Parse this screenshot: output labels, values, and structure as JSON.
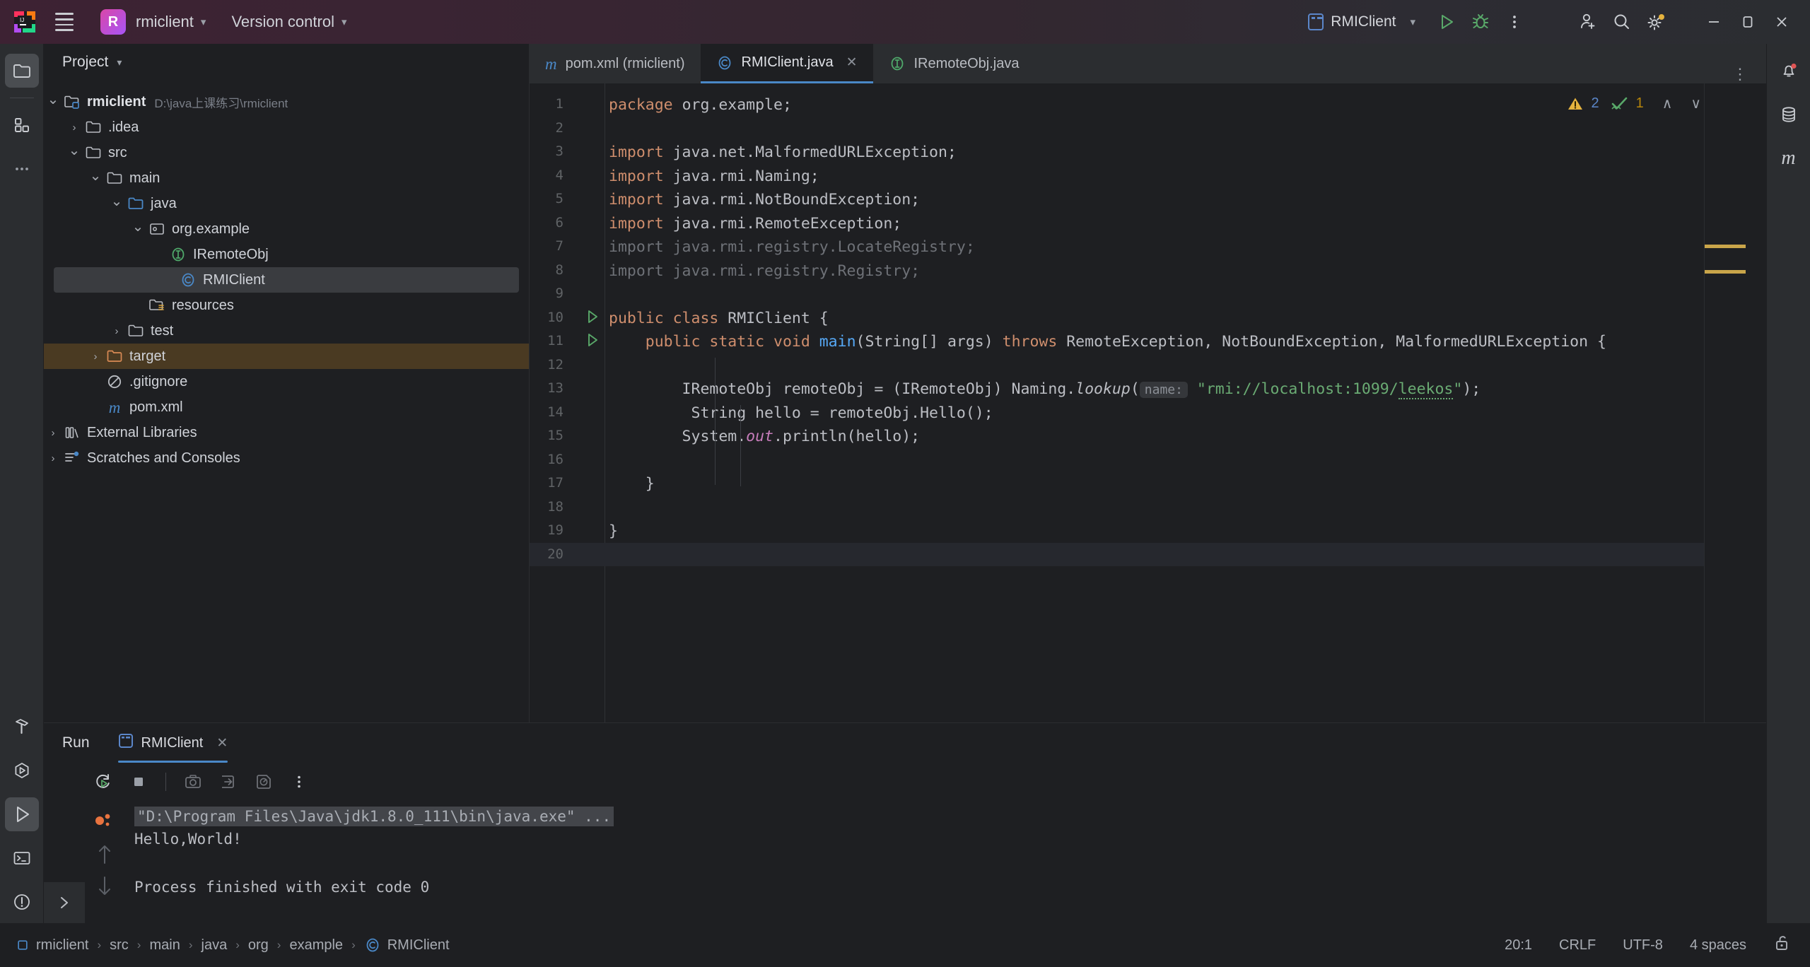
{
  "titlebar": {
    "menu_icon": "hamburger-menu-icon",
    "project_initial": "R",
    "project_name": "rmiclient",
    "version_control": "Version control",
    "run_config_name": "RMIClient",
    "icons": [
      "run-icon",
      "debug-icon",
      "more-options-icon",
      "add-user-icon",
      "search-icon",
      "settings-icon",
      "minimize-icon",
      "restore-icon",
      "close-icon"
    ]
  },
  "left_rail": {
    "top": [
      {
        "name": "project-tool-window",
        "icon": "folder-icon",
        "selected": true
      },
      {
        "name": "structure-tool-window",
        "icon": "blocks-icon",
        "selected": false
      },
      {
        "name": "more-tool-windows",
        "icon": "ellipsis-icon",
        "selected": false
      }
    ],
    "bottom": [
      {
        "name": "build-tool-window",
        "icon": "hammer-icon",
        "selected": false
      },
      {
        "name": "run-with-coverage",
        "icon": "coverage-icon",
        "selected": false
      },
      {
        "name": "run-tool-window",
        "icon": "run-triangle-icon",
        "selected": true
      },
      {
        "name": "terminal-tool-window",
        "icon": "terminal-icon",
        "selected": false
      },
      {
        "name": "problems-tool-window",
        "icon": "warning-circle-icon",
        "selected": false
      },
      {
        "name": "version-control-tool-window",
        "icon": "git-branch-icon",
        "selected": false
      }
    ]
  },
  "right_rail": [
    {
      "name": "notifications",
      "icon": "bell-icon",
      "badge": true
    },
    {
      "name": "database-tool-window",
      "icon": "database-icon",
      "badge": false
    },
    {
      "name": "maven-tool-window",
      "icon": "maven-m-icon",
      "badge": false
    }
  ],
  "project_panel": {
    "title": "Project",
    "tree": [
      {
        "depth": 0,
        "label": "rmiclient",
        "path": "D:\\java上课练习\\rmiclient",
        "arrow": "down",
        "icon": "module-icon",
        "bold": true,
        "state": "normal"
      },
      {
        "depth": 1,
        "label": ".idea",
        "path": "",
        "arrow": "right",
        "icon": "folder-icon",
        "bold": false,
        "state": "normal"
      },
      {
        "depth": 1,
        "label": "src",
        "path": "",
        "arrow": "down",
        "icon": "folder-icon",
        "bold": false,
        "state": "normal"
      },
      {
        "depth": 2,
        "label": "main",
        "path": "",
        "arrow": "down",
        "icon": "folder-icon",
        "bold": false,
        "state": "normal"
      },
      {
        "depth": 3,
        "label": "java",
        "path": "",
        "arrow": "down",
        "icon": "source-folder-icon",
        "bold": false,
        "state": "normal"
      },
      {
        "depth": 4,
        "label": "org.example",
        "path": "",
        "arrow": "down",
        "icon": "package-icon",
        "bold": false,
        "state": "normal"
      },
      {
        "depth": 5,
        "label": "IRemoteObj",
        "path": "",
        "arrow": "none",
        "icon": "interface-icon",
        "bold": false,
        "state": "normal"
      },
      {
        "depth": 5,
        "label": "RMIClient",
        "path": "",
        "arrow": "none",
        "icon": "class-icon",
        "bold": false,
        "state": "selected"
      },
      {
        "depth": 4,
        "label": "resources",
        "path": "",
        "arrow": "none",
        "icon": "resources-folder-icon",
        "bold": false,
        "state": "normal"
      },
      {
        "depth": 3,
        "label": "test",
        "path": "",
        "arrow": "right",
        "icon": "folder-icon",
        "bold": false,
        "state": "normal"
      },
      {
        "depth": 2,
        "label": "target",
        "path": "",
        "arrow": "right",
        "icon": "excluded-folder-icon",
        "bold": false,
        "state": "highlighted"
      },
      {
        "depth": 2,
        "label": ".gitignore",
        "path": "",
        "arrow": "none",
        "icon": "gitignore-icon",
        "bold": false,
        "state": "normal"
      },
      {
        "depth": 2,
        "label": "pom.xml",
        "path": "",
        "arrow": "none",
        "icon": "maven-m-icon",
        "bold": false,
        "state": "normal"
      },
      {
        "depth": 0,
        "label": "External Libraries",
        "path": "",
        "arrow": "right",
        "icon": "libraries-icon",
        "bold": false,
        "state": "normal"
      },
      {
        "depth": 0,
        "label": "Scratches and Consoles",
        "path": "",
        "arrow": "right",
        "icon": "scratches-icon",
        "bold": false,
        "state": "normal"
      }
    ]
  },
  "editor": {
    "tabs": [
      {
        "label": "pom.xml (rmiclient)",
        "icon": "maven-m-icon",
        "active": false,
        "closable": false
      },
      {
        "label": "RMIClient.java",
        "icon": "class-icon",
        "active": true,
        "closable": true
      },
      {
        "label": "IRemoteObj.java",
        "icon": "interface-icon",
        "active": false,
        "closable": false
      }
    ],
    "tab_close_label": "✕",
    "more_label": "⋮",
    "inspection": {
      "warning_icon": "warning-triangle-icon",
      "warning_count": "2",
      "ok_icon": "inspection-ok-icon",
      "ok_count": "1",
      "prev_label": "∧",
      "next_label": "∨"
    },
    "current_line": 20,
    "lines": [
      {
        "n": 1,
        "runmark": false,
        "tokens": [
          {
            "t": "package ",
            "c": "kw"
          },
          {
            "t": "org.example;",
            "c": ""
          }
        ]
      },
      {
        "n": 2,
        "runmark": false,
        "tokens": []
      },
      {
        "n": 3,
        "runmark": false,
        "tokens": [
          {
            "t": "import ",
            "c": "kw"
          },
          {
            "t": "java.net.MalformedURLException;",
            "c": ""
          }
        ]
      },
      {
        "n": 4,
        "runmark": false,
        "tokens": [
          {
            "t": "import ",
            "c": "kw"
          },
          {
            "t": "java.rmi.Naming;",
            "c": ""
          }
        ]
      },
      {
        "n": 5,
        "runmark": false,
        "tokens": [
          {
            "t": "import ",
            "c": "kw"
          },
          {
            "t": "java.rmi.NotBoundException;",
            "c": ""
          }
        ]
      },
      {
        "n": 6,
        "runmark": false,
        "tokens": [
          {
            "t": "import ",
            "c": "kw"
          },
          {
            "t": "java.rmi.RemoteException;",
            "c": ""
          }
        ]
      },
      {
        "n": 7,
        "runmark": false,
        "tokens": [
          {
            "t": "import java.rmi.registry.LocateRegistry;",
            "c": "dim"
          }
        ]
      },
      {
        "n": 8,
        "runmark": false,
        "tokens": [
          {
            "t": "import java.rmi.registry.Registry;",
            "c": "dim"
          }
        ]
      },
      {
        "n": 9,
        "runmark": false,
        "tokens": []
      },
      {
        "n": 10,
        "runmark": true,
        "tokens": [
          {
            "t": "public class ",
            "c": "kw"
          },
          {
            "t": "RMIClient {",
            "c": ""
          }
        ]
      },
      {
        "n": 11,
        "runmark": true,
        "tokens": [
          {
            "t": "    ",
            "c": ""
          },
          {
            "t": "public static void ",
            "c": "kw"
          },
          {
            "t": "main",
            "c": "fn"
          },
          {
            "t": "(String[] args) ",
            "c": ""
          },
          {
            "t": "throws ",
            "c": "kw"
          },
          {
            "t": "RemoteException, NotBoundException, MalformedURLException {",
            "c": ""
          }
        ]
      },
      {
        "n": 12,
        "runmark": false,
        "tokens": []
      },
      {
        "n": 13,
        "runmark": false,
        "tokens": [
          {
            "t": "        IRemoteObj remoteObj = (IRemoteObj) Naming.",
            "c": ""
          },
          {
            "t": "lookup",
            "c": "it"
          },
          {
            "t": "(",
            "c": ""
          },
          {
            "t": "name:",
            "c": "hint"
          },
          {
            "t": "\"rmi://localhost:1099/",
            "c": "str"
          },
          {
            "t": "leekos",
            "c": "str-squig"
          },
          {
            "t": "\"",
            "c": "str"
          },
          {
            "t": ");",
            "c": ""
          }
        ]
      },
      {
        "n": 14,
        "runmark": false,
        "tokens": [
          {
            "t": "         String hello = remoteObj.Hello();",
            "c": ""
          }
        ]
      },
      {
        "n": 15,
        "runmark": false,
        "tokens": [
          {
            "t": "        System.",
            "c": ""
          },
          {
            "t": "out",
            "c": "fld"
          },
          {
            "t": ".println(hello);",
            "c": ""
          }
        ]
      },
      {
        "n": 16,
        "runmark": false,
        "tokens": []
      },
      {
        "n": 17,
        "runmark": false,
        "tokens": [
          {
            "t": "    }",
            "c": ""
          }
        ]
      },
      {
        "n": 18,
        "runmark": false,
        "tokens": []
      },
      {
        "n": 19,
        "runmark": false,
        "tokens": [
          {
            "t": "}",
            "c": ""
          }
        ]
      },
      {
        "n": 20,
        "runmark": false,
        "tokens": []
      }
    ],
    "marker_color": "#c9a54a"
  },
  "run_panel": {
    "tool_window_label": "Run",
    "tab_label": "RMIClient",
    "tab_icon": "run-config-icon",
    "tab_close": "✕",
    "toolbar": [
      {
        "name": "rerun-button",
        "icon": "rerun-icon"
      },
      {
        "name": "stop-button",
        "icon": "stop-icon"
      },
      {
        "name": "screenshot-button",
        "icon": "camera-icon"
      },
      {
        "name": "dump-threads-button",
        "icon": "dump-icon"
      },
      {
        "name": "profiler-button",
        "icon": "profiler-icon"
      },
      {
        "name": "more-options-button",
        "icon": "ellipsis-vertical-icon"
      }
    ],
    "console": [
      {
        "text": "\"D:\\Program Files\\Java\\jdk1.8.0_111\\bin\\java.exe\" ...",
        "style": "command"
      },
      {
        "text": "Hello,World!",
        "style": "plain"
      },
      {
        "text": "",
        "style": "plain"
      },
      {
        "text": "Process finished with exit code 0",
        "style": "plain"
      }
    ],
    "gutter_icons": [
      "run-dots-icon",
      "scroll-up-icon",
      "scroll-down-icon"
    ],
    "expander_icon": "chevron-right-icon"
  },
  "status_bar": {
    "breadcrumb": [
      {
        "label": "rmiclient",
        "icon": "module-square-icon"
      },
      {
        "label": "src",
        "icon": ""
      },
      {
        "label": "main",
        "icon": ""
      },
      {
        "label": "java",
        "icon": ""
      },
      {
        "label": "org",
        "icon": ""
      },
      {
        "label": "example",
        "icon": ""
      },
      {
        "label": "RMIClient",
        "icon": "class-icon"
      }
    ],
    "separator": "›",
    "caret_position": "20:1",
    "line_separator": "CRLF",
    "encoding": "UTF-8",
    "indent": "4 spaces",
    "lock_icon": "unlocked-icon"
  },
  "colors": {
    "accent_blue": "#4a88c7",
    "warning_yellow": "#c9a54a",
    "string_green": "#6aab73",
    "keyword_orange": "#cf8e6d",
    "bg": "#1e1f22",
    "panel_bg": "#2b2d30"
  }
}
